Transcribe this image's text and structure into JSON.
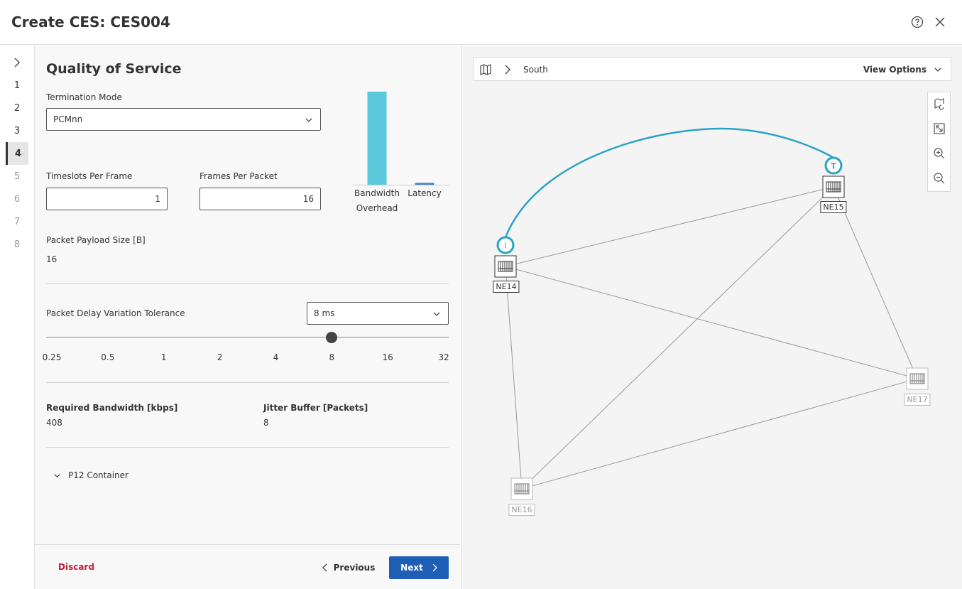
{
  "dialog": {
    "title": "Create CES: CES004"
  },
  "stepper": {
    "steps": [
      "1",
      "2",
      "3",
      "4",
      "5",
      "6",
      "7",
      "8"
    ],
    "active": "4"
  },
  "form": {
    "section_title": "Quality of Service",
    "termination_mode": {
      "label": "Termination Mode",
      "value": "PCMnn"
    },
    "timeslots": {
      "label": "Timeslots Per Frame",
      "value": "1"
    },
    "frames": {
      "label": "Frames Per Packet",
      "value": "16"
    },
    "payload": {
      "label": "Packet Payload Size [B]",
      "value": "16"
    },
    "pdv": {
      "label": "Packet Delay Variation Tolerance",
      "value": "8 ms",
      "ticks": [
        "0.25",
        "0.5",
        "1",
        "2",
        "4",
        "8",
        "16",
        "32"
      ],
      "selected_index": 5
    },
    "bandwidth": {
      "label": "Required Bandwidth [kbps]",
      "value": "408"
    },
    "jitter": {
      "label": "Jitter Buffer [Packets]",
      "value": "8"
    },
    "container": {
      "label": "P12 Container"
    }
  },
  "mini_chart": {
    "categories": [
      "Bandwidth Overhead",
      "Latency"
    ],
    "category_lines": [
      [
        "Bandwidth",
        "Overhead"
      ],
      [
        "Latency"
      ]
    ],
    "values": [
      1.0,
      0.02
    ],
    "colors": [
      "#5bc8dc",
      "#4a7fc1"
    ]
  },
  "footer": {
    "discard": "Discard",
    "previous": "Previous",
    "next": "Next"
  },
  "map": {
    "breadcrumb": "South",
    "view_options": "View Options",
    "nodes": [
      {
        "id": "NE14",
        "label": "NE14",
        "marker": "I",
        "dim": false
      },
      {
        "id": "NE15",
        "label": "NE15",
        "marker": "T",
        "dim": false
      },
      {
        "id": "NE16",
        "label": "NE16",
        "marker": "",
        "dim": true
      },
      {
        "id": "NE17",
        "label": "NE17",
        "marker": "",
        "dim": true
      }
    ],
    "accent_color": "#2aa3c4"
  }
}
